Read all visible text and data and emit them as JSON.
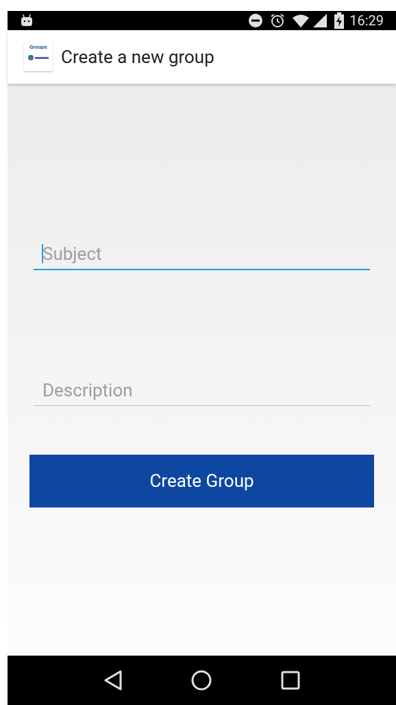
{
  "status_bar": {
    "time": "16:29"
  },
  "app_bar": {
    "logo_text": "Groups",
    "title": "Create a new group"
  },
  "form": {
    "fields": [
      {
        "placeholder": "Subject",
        "focused": true
      },
      {
        "placeholder": "Description",
        "focused": false
      }
    ],
    "submit": "Create Group"
  }
}
